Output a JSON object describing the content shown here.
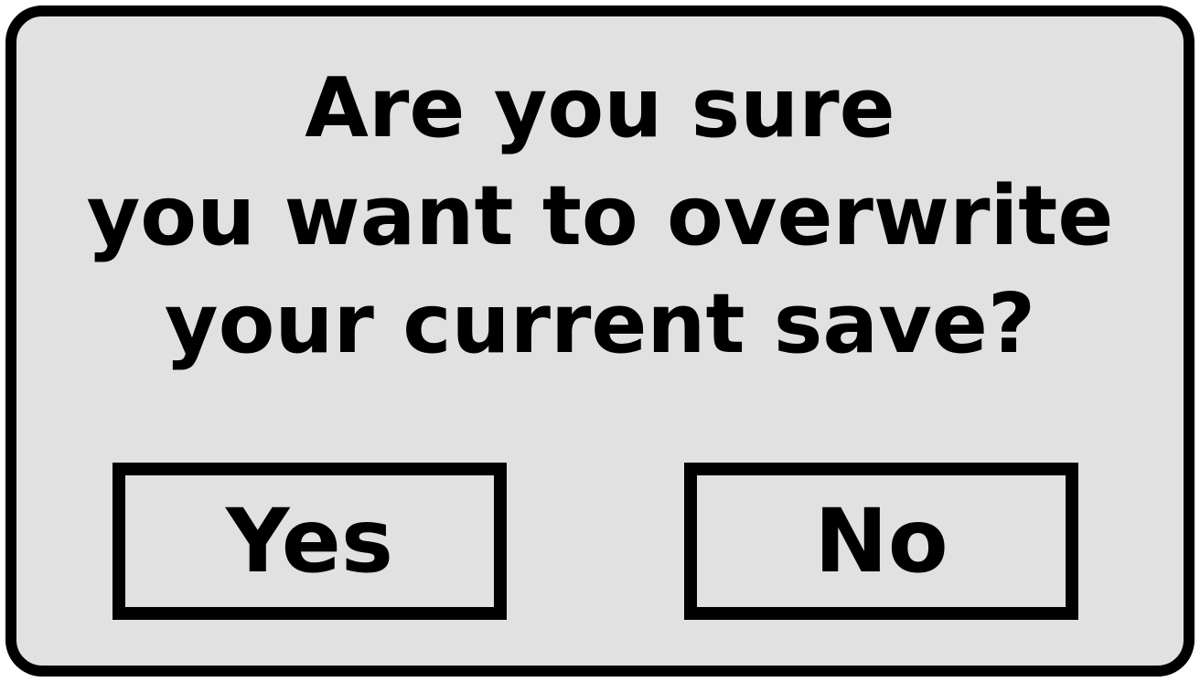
{
  "dialog": {
    "message_lines": [
      "Are you sure",
      "you want to overwrite",
      "your current save?"
    ],
    "buttons": {
      "yes_label": "Yes",
      "no_label": "No"
    },
    "colors": {
      "background": "#e1e1e1",
      "border": "#000000",
      "text": "#000000"
    }
  }
}
